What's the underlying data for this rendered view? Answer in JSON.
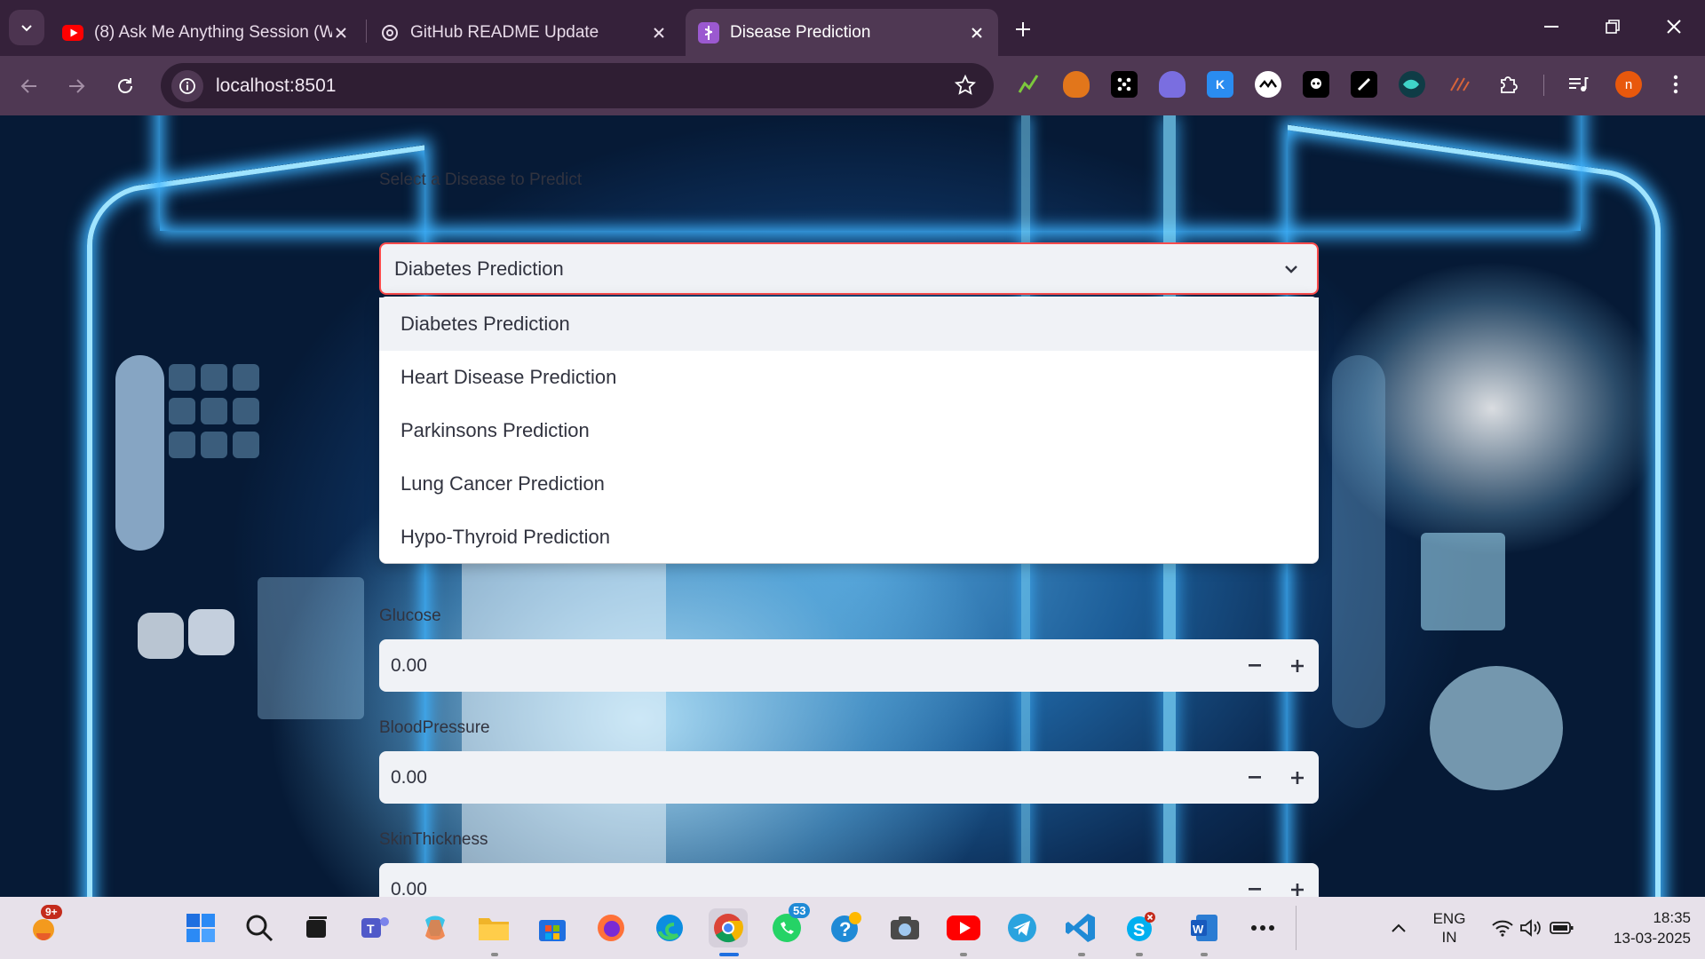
{
  "browser": {
    "tabs": [
      {
        "title": "(8) Ask Me Anything Session (W",
        "icon": "youtube-icon",
        "active": false
      },
      {
        "title": "GitHub README Update",
        "icon": "chatgpt-icon",
        "active": false
      },
      {
        "title": "Disease Prediction",
        "icon": "streamlit-icon",
        "active": true
      }
    ],
    "url": "localhost:8501",
    "profile_initial": "n",
    "extensions": [
      "chart-extension-icon",
      "metamask-icon",
      "dice-extension-icon",
      "ghost-extension-icon",
      "k-extension-icon",
      "wave-extension-icon",
      "robot-extension-icon",
      "pen-extension-icon",
      "fish-extension-icon",
      "signal-extension-icon",
      "puzzle-extensions-icon"
    ]
  },
  "app": {
    "select_label": "Select a Disease to Predict",
    "selected": "Diabetes Prediction",
    "options": [
      "Diabetes Prediction",
      "Heart Disease Prediction",
      "Parkinsons Prediction",
      "Lung Cancer Prediction",
      "Hypo-Thyroid Prediction"
    ],
    "fields": [
      {
        "label": "Glucose",
        "value": "0.00"
      },
      {
        "label": "BloodPressure",
        "value": "0.00"
      },
      {
        "label": "SkinThickness",
        "value": "0.00"
      }
    ],
    "stepper": {
      "minus": "−",
      "plus": "+"
    }
  },
  "taskbar": {
    "weather_badge": "9+",
    "whatsapp_badge": "53",
    "language": "ENG",
    "region": "IN",
    "time": "18:35",
    "date": "13-03-2025"
  }
}
